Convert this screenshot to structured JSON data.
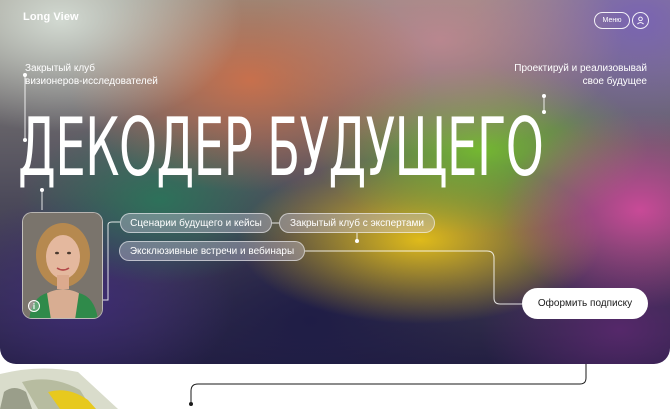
{
  "header": {
    "logo": "Long View",
    "menu_label": "Меню"
  },
  "hero": {
    "subtitle_left_line1": "Закрытый клуб",
    "subtitle_left_line2": "визионеров-исследователей",
    "subtitle_right_line1": "Проектируй и реализовывай",
    "subtitle_right_line2": "свое будущее",
    "title": "ДЕКОДЕР БУДУЩЕГО",
    "tags": [
      "Сценарии будущего и кейсы",
      "Закрытый клуб с экспертами",
      "Эксклюзивные встречи и вебинары"
    ],
    "info_icon": "i",
    "cta_label": "Оформить подписку"
  },
  "icons": {
    "user": "user-icon",
    "info": "info-icon"
  },
  "colors": {
    "cta_background": "#ffffff",
    "text": "#ffffff"
  }
}
